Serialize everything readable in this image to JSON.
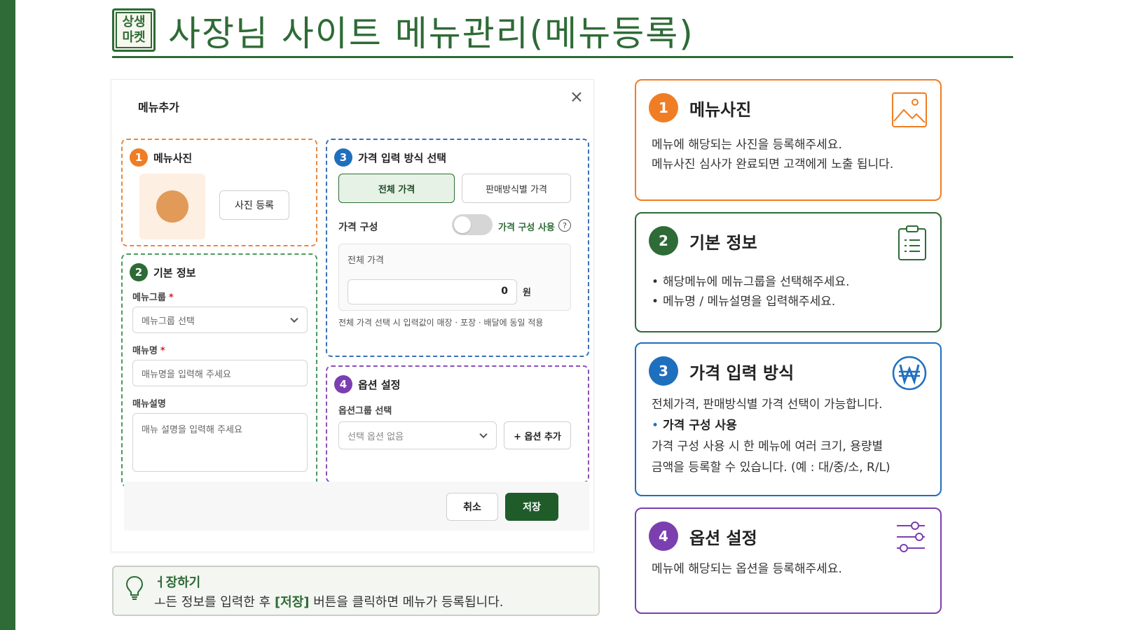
{
  "header": {
    "logo_top": "상생",
    "logo_bottom": "마켓",
    "title": "사장님 사이트 메뉴관리(메뉴등록)"
  },
  "modal": {
    "title": "메뉴추가",
    "close_icon": "×",
    "section1": {
      "num": "1",
      "title": "메뉴사진",
      "photo_button": "사진 등록"
    },
    "section2": {
      "num": "2",
      "title": "기본 정보",
      "group_label": "메뉴그룹",
      "required_mark": "*",
      "group_select": "메뉴그룹 선택",
      "name_label": "매뉴명",
      "name_placeholder": "매뉴명을 입력해 주세요",
      "desc_label": "매뉴설명",
      "desc_placeholder": "매뉴 설명을 입력해 주세요"
    },
    "section3": {
      "num": "3",
      "title": "가격 입력 방식 선택",
      "tab_all": "전체 가격",
      "tab_by_method": "판매방식별 가격",
      "price_config_label": "가격 구성",
      "toggle_label": "가격 구성 사용",
      "help": "?",
      "price_box_title": "전체 가격",
      "price_value": "0",
      "currency": "원",
      "note": "전체 가격 선택 시 입력값이 매장 · 포장 · 배달에 동일 적용"
    },
    "section4": {
      "num": "4",
      "title": "옵션 설정",
      "group_label": "옵션그룹 선택",
      "select_value": "선택 옵션 없음",
      "add_button": "+ 옵션 추가"
    },
    "cancel_button": "취소",
    "save_button": "저장"
  },
  "tip": {
    "title": "ㅓ장하기",
    "text_before": "ㅗ든 정보를 입력한 후 ",
    "text_bold": "[저장]",
    "text_after": " 버튼을 클릭하면 메뉴가 등록됩니다."
  },
  "cards": [
    {
      "num": "1",
      "title": "메뉴사진",
      "icon": "image-icon",
      "line1": "메뉴에 해당되는 사진을 등록해주세요.",
      "line2": "메뉴사진 심사가 완료되면 고객에게 노출 됩니다."
    },
    {
      "num": "2",
      "title": "기본 정보",
      "icon": "clipboard-icon",
      "bullet1": "해당메뉴에 메뉴그룹을 선택해주세요.",
      "bullet2": "메뉴명 / 메뉴설명을 입력해주세요."
    },
    {
      "num": "3",
      "title": "가격 입력 방식",
      "icon": "won-icon",
      "line1": "전체가격, 판매방식별 가격 선택이 가능합니다.",
      "bullet_bold": "가격 구성 사용",
      "line2": "가격 구성 사용 시 한 메뉴에 여러 크기, 용량별",
      "line3": "금액을 등록할 수 있습니다. (예 : 대/중/소, R/L)"
    },
    {
      "num": "4",
      "title": "옵션 설정",
      "icon": "sliders-icon",
      "line1": "메뉴에 해당되는 옵션을 등록해주세요."
    }
  ],
  "colors": {
    "brand_green": "#2e6b36",
    "orange": "#f07d24",
    "blue": "#1f6fbf",
    "purple": "#7b3fb0"
  }
}
